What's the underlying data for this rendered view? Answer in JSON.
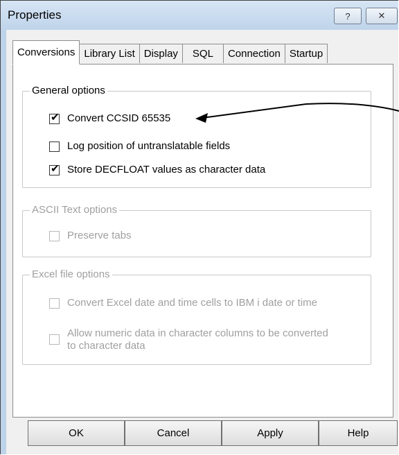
{
  "window": {
    "title": "Properties",
    "help_glyph": "?",
    "close_glyph": "✕"
  },
  "tabs": [
    {
      "label": "Conversions",
      "active": true
    },
    {
      "label": "Library List",
      "active": false
    },
    {
      "label": "Display",
      "active": false
    },
    {
      "label": "SQL",
      "active": false
    },
    {
      "label": "Connection",
      "active": false
    },
    {
      "label": "Startup",
      "active": false
    }
  ],
  "general": {
    "title": "General options",
    "options": [
      {
        "label": "Convert CCSID 65535",
        "checked": true
      },
      {
        "label": "Log position of untranslatable fields",
        "checked": false
      },
      {
        "label": "Store DECFLOAT values as character data",
        "checked": true
      }
    ]
  },
  "ascii": {
    "title": "ASCII Text options",
    "options": [
      {
        "label": "Preserve tabs",
        "checked": false
      }
    ]
  },
  "excel": {
    "title": "Excel file options",
    "options": [
      {
        "label": "Convert Excel date and time cells to IBM i date or time",
        "checked": false
      },
      {
        "label": "Allow numeric data in character columns to be converted to character data",
        "checked": false
      }
    ]
  },
  "buttons": {
    "ok": "OK",
    "cancel": "Cancel",
    "apply": "Apply",
    "help": "Help"
  },
  "colors": {
    "titlebar": "#bfd4ea",
    "annotation_arrow": "#000000"
  }
}
